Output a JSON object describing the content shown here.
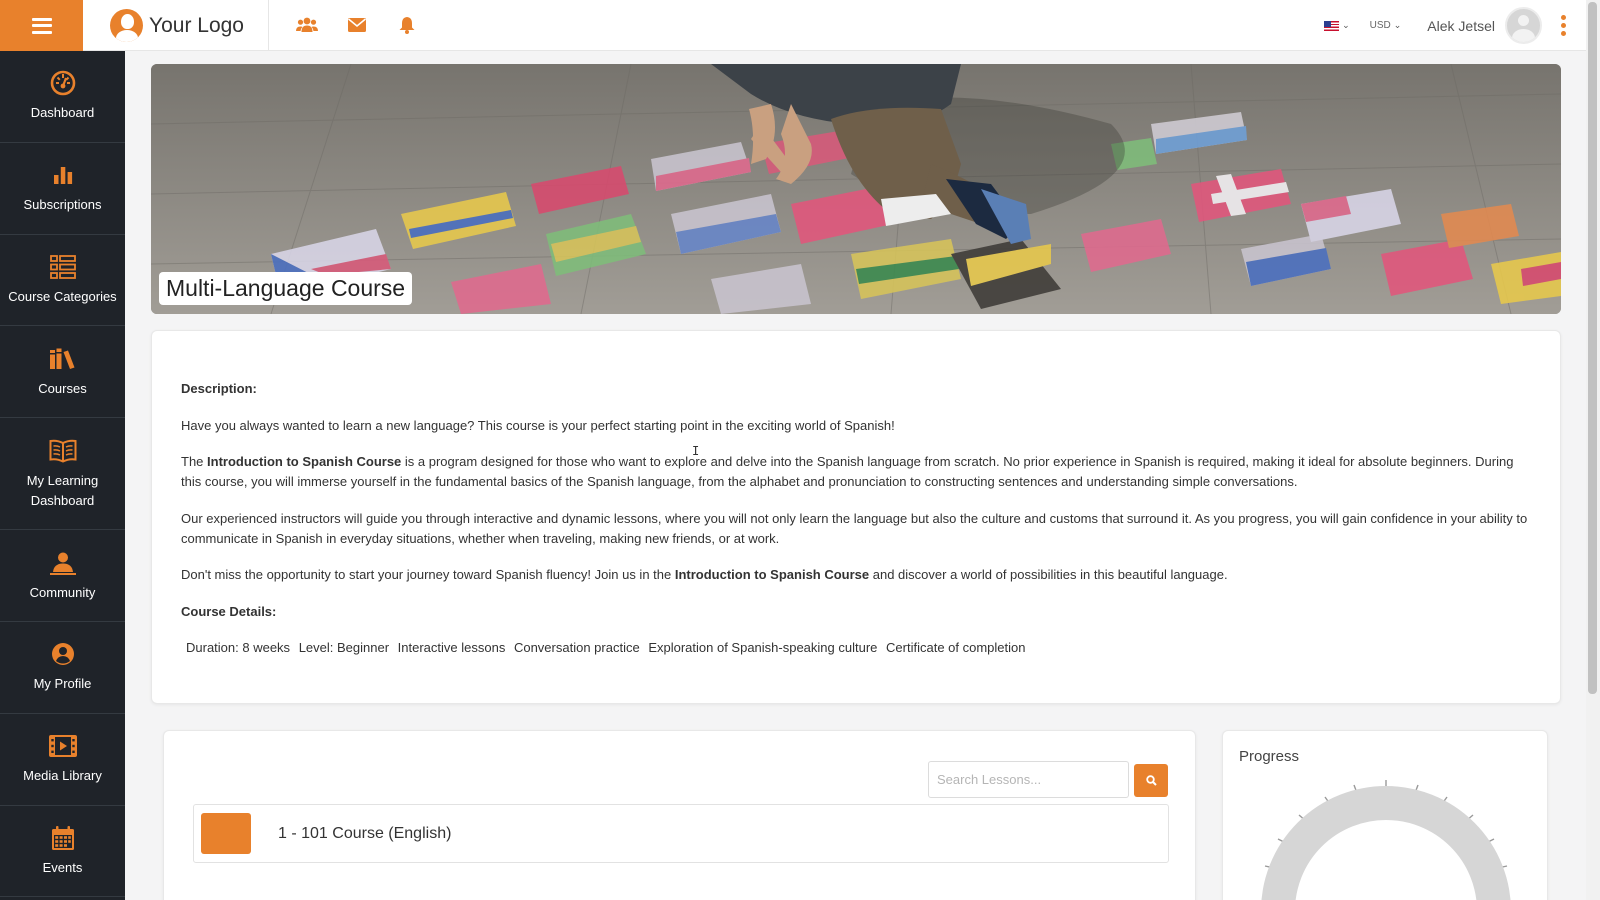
{
  "header": {
    "logo_text": "Your Logo",
    "currency": "USD",
    "user_name": "Alek Jetsel",
    "icons": [
      "menu-icon",
      "group-icon",
      "envelope-icon",
      "bell-icon"
    ],
    "accent_color": "#e8812c"
  },
  "sidebar": {
    "items": [
      {
        "label": "Dashboard",
        "icon": "gauge-icon"
      },
      {
        "label": "Subscriptions",
        "icon": "bar-chart-icon"
      },
      {
        "label": "Course Categories",
        "icon": "list-icon"
      },
      {
        "label": "Courses",
        "icon": "books-icon"
      },
      {
        "label": "My Learning Dashboard",
        "icon": "open-book-icon"
      },
      {
        "label": "Community",
        "icon": "community-icon"
      },
      {
        "label": "My Profile",
        "icon": "user-circle-icon"
      },
      {
        "label": "Media Library",
        "icon": "film-icon"
      },
      {
        "label": "Events",
        "icon": "calendar-icon"
      }
    ]
  },
  "hero": {
    "title": "Multi-Language Course"
  },
  "description": {
    "heading": "Description:",
    "intro": "Have you always wanted to learn a new language? This course is your perfect starting point in the exciting world of Spanish!",
    "p2_pre": "The ",
    "course_name": "Introduction to Spanish Course",
    "p2_post": " is a program designed for those who want to explore and delve into the Spanish language from scratch. No prior experience in Spanish is required, making it ideal for absolute beginners. During this course, you will immerse yourself in the fundamental basics of the Spanish language, from the alphabet and pronunciation to constructing sentences and understanding simple conversations.",
    "p3": "Our experienced instructors will guide you through interactive and dynamic lessons, where you will not only learn the language but also the culture and customs that surround it. As you progress, you will gain confidence in your ability to communicate in Spanish in everyday situations, whether when traveling, making new friends, or at work.",
    "p4_pre": "Don't miss the opportunity to start your journey toward Spanish fluency! Join us in the ",
    "p4_post": " and discover a world of possibilities in this beautiful language.",
    "details_heading": "Course Details:",
    "details": [
      "Duration: 8 weeks",
      "Level: Beginner",
      "Interactive lessons",
      "Conversation practice",
      "Exploration of Spanish-speaking culture",
      "Certificate of completion"
    ]
  },
  "lessons": {
    "search_placeholder": "Search Lessons...",
    "items": [
      {
        "title": "1 - 101 Course (English)"
      }
    ]
  },
  "progress": {
    "title": "Progress"
  }
}
